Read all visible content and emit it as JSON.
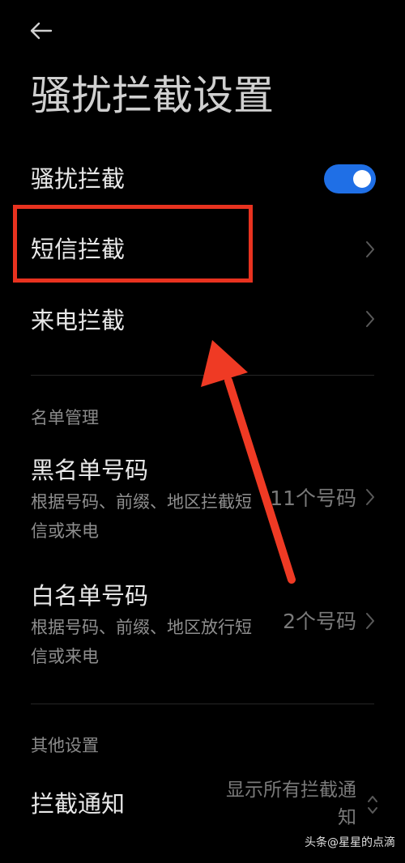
{
  "header": {
    "title": "骚扰拦截设置"
  },
  "rows": {
    "harassment": {
      "label": "骚扰拦截",
      "enabled": true
    },
    "sms": {
      "label": "短信拦截"
    },
    "call": {
      "label": "来电拦截"
    }
  },
  "list_section": {
    "header": "名单管理",
    "blacklist": {
      "title": "黑名单号码",
      "desc": "根据号码、前缀、地区拦截短信或来电",
      "value": "11个号码"
    },
    "whitelist": {
      "title": "白名单号码",
      "desc": "根据号码、前缀、地区放行短信或来电",
      "value": "2个号码"
    }
  },
  "other_section": {
    "header": "其他设置",
    "notify": {
      "title": "拦截通知",
      "value": "显示所有拦截通知"
    }
  },
  "watermark": "头条@星星的点滴",
  "colors": {
    "toggle_on": "#1f6fe6",
    "highlight": "#e8321f",
    "arrow": "#ef3a24"
  }
}
